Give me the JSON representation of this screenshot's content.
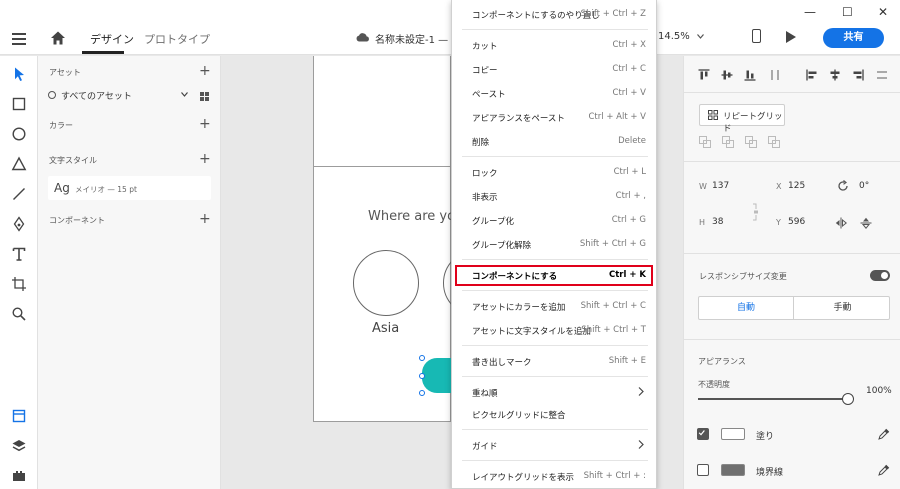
{
  "topbar": {
    "tabs": [
      "デザイン",
      "プロトタイプ"
    ],
    "doc_title": "名称未設定-1 — ",
    "zoom": "14.5%",
    "share_label": "共有",
    "window_controls": [
      "—",
      "☐",
      "✕"
    ]
  },
  "assets": {
    "section_assets": "アセット",
    "search_value": "すべてのアセット",
    "section_colors": "カラー",
    "section_text_styles": "文字スタイル",
    "font_preview": "Ag",
    "font_desc": "メイリオ — 15 pt",
    "section_components": "コンポーネント"
  },
  "artboard": {
    "heading": "Where are yo",
    "region_label": "Asia"
  },
  "context_menu": {
    "items": [
      {
        "label": "コンポーネントにするのやり直し",
        "shortcut": "Shift + Ctrl + Z"
      },
      {
        "label": "カット",
        "shortcut": "Ctrl + X"
      },
      {
        "label": "コピー",
        "shortcut": "Ctrl + C"
      },
      {
        "label": "ペースト",
        "shortcut": "Ctrl + V"
      },
      {
        "label": "アピアランスをペースト",
        "shortcut": "Ctrl + Alt + V"
      },
      {
        "label": "削除",
        "shortcut": "Delete"
      },
      {
        "label": "ロック",
        "shortcut": "Ctrl + L"
      },
      {
        "label": "非表示",
        "shortcut": "Ctrl + ,"
      },
      {
        "label": "グループ化",
        "shortcut": "Ctrl + G"
      },
      {
        "label": "グループ化解除",
        "shortcut": "Shift + Ctrl + G"
      },
      {
        "label": "コンポーネントにする",
        "shortcut": "Ctrl + K"
      },
      {
        "label": "アセットにカラーを追加",
        "shortcut": "Shift + Ctrl + C"
      },
      {
        "label": "アセットに文字スタイルを追加",
        "shortcut": "Shift + Ctrl + T"
      },
      {
        "label": "書き出しマーク",
        "shortcut": "Shift + E"
      },
      {
        "label": "重ね順",
        "shortcut": ""
      },
      {
        "label": "ピクセルグリッドに整合",
        "shortcut": ""
      },
      {
        "label": "ガイド",
        "shortcut": ""
      },
      {
        "label": "レイアウトグリッドを表示",
        "shortcut": "Shift + Ctrl + :"
      }
    ]
  },
  "props": {
    "repeat_grid_label": "リピートグリッド",
    "w_label": "W",
    "w_value": "137",
    "x_label": "X",
    "x_value": "125",
    "rotation_value": "0°",
    "h_label": "H",
    "h_value": "38",
    "y_label": "Y",
    "y_value": "596",
    "responsive_label": "レスポンシブサイズ変更",
    "auto_label": "自動",
    "manual_label": "手動",
    "appearance_label": "アピアランス",
    "opacity_label": "不透明度",
    "opacity_value": "100%",
    "fill_label": "塗り",
    "stroke_label": "境界線"
  },
  "colors": {
    "accent": "#1473e6",
    "highlight": "#e0001a",
    "teal_shape": "#17b9b4"
  }
}
